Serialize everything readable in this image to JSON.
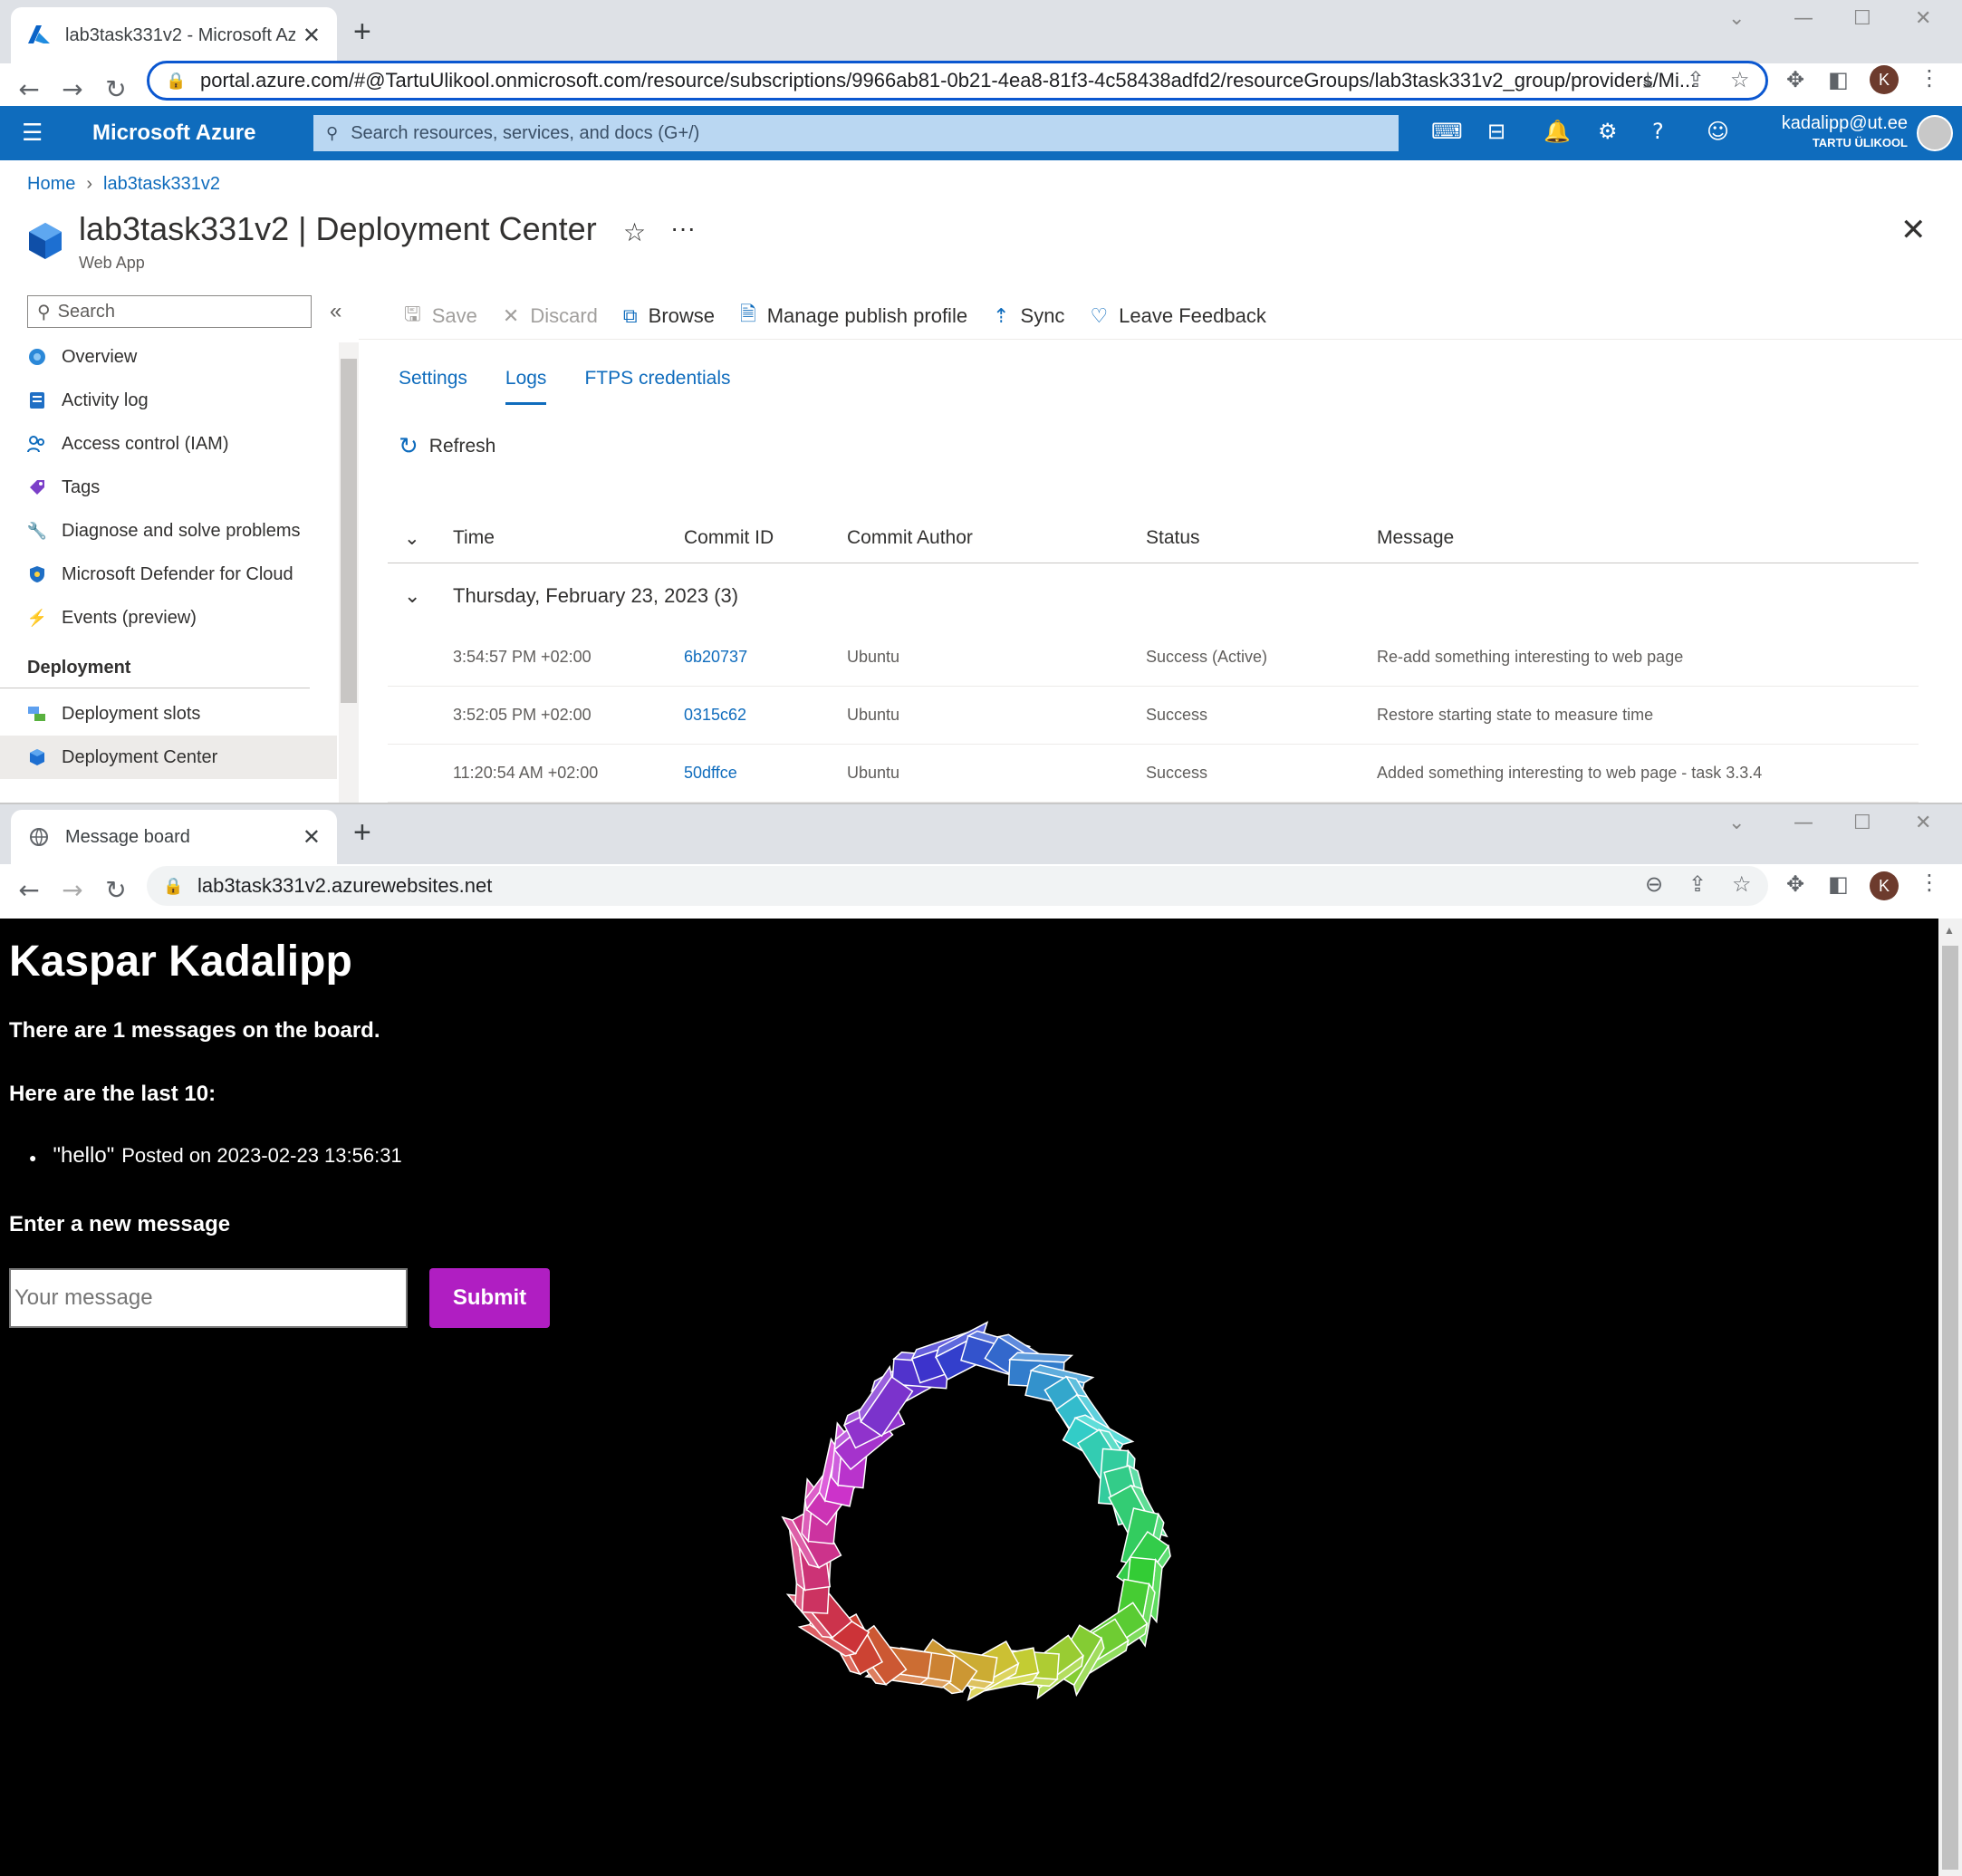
{
  "browser1": {
    "tab_title": "lab3task331v2 - Microsoft Azure",
    "url": "portal.azure.com/#@TartuUlikool.onmicrosoft.com/resource/subscriptions/9966ab81-0b21-4ea8-81f3-4c58438adfd2/resourceGroups/lab3task331v2_group/providers/Mi...",
    "profile_initial": "K"
  },
  "azure": {
    "brand": "Microsoft Azure",
    "search_placeholder": "Search resources, services, and docs (G+/)",
    "user_email": "kadalipp@ut.ee",
    "user_org": "TARTU ÜLIKOOL",
    "breadcrumb": [
      "Home",
      "lab3task331v2"
    ],
    "title": "lab3task331v2 | Deployment Center",
    "subtitle": "Web App",
    "side_search": "Search",
    "nav": [
      {
        "label": "Overview",
        "icon": "globe-icon"
      },
      {
        "label": "Activity log",
        "icon": "log-icon"
      },
      {
        "label": "Access control (IAM)",
        "icon": "people-icon"
      },
      {
        "label": "Tags",
        "icon": "tag-icon"
      },
      {
        "label": "Diagnose and solve problems",
        "icon": "wrench-icon"
      },
      {
        "label": "Microsoft Defender for Cloud",
        "icon": "shield-icon"
      },
      {
        "label": "Events (preview)",
        "icon": "lightning-icon"
      }
    ],
    "nav_section": "Deployment",
    "nav2": [
      {
        "label": "Deployment slots",
        "icon": "slots-icon"
      },
      {
        "label": "Deployment Center",
        "icon": "cube-icon"
      }
    ],
    "toolbar": {
      "save": "Save",
      "discard": "Discard",
      "browse": "Browse",
      "manage": "Manage publish profile",
      "sync": "Sync",
      "feedback": "Leave Feedback"
    },
    "tabs": [
      "Settings",
      "Logs",
      "FTPS credentials"
    ],
    "refresh": "Refresh",
    "columns": [
      "Time",
      "Commit ID",
      "Commit Author",
      "Status",
      "Message"
    ],
    "group_label": "Thursday, February 23, 2023 (3)",
    "rows": [
      [
        "3:54:57 PM +02:00",
        "6b20737",
        "Ubuntu",
        "Success (Active)",
        "Re-add something interesting to web page"
      ],
      [
        "3:52:05 PM +02:00",
        "0315c62",
        "Ubuntu",
        "Success",
        "Restore starting state to measure time"
      ],
      [
        "11:20:54 AM +02:00",
        "50dffce",
        "Ubuntu",
        "Success",
        "Added something interesting to web page - task 3.3.4"
      ]
    ]
  },
  "browser2": {
    "tab_title": "Message board",
    "url": "lab3task331v2.azurewebsites.net",
    "profile_initial": "K"
  },
  "board": {
    "heading": "Kaspar Kadalipp",
    "count_text": "There are 1 messages on the board.",
    "last_text": "Here are the last 10:",
    "messages": [
      {
        "text": "\"hello\"",
        "posted": "Posted on 2023-02-23 13:56:31"
      }
    ],
    "new_label": "Enter a new message",
    "input_placeholder": "Your message",
    "submit": "Submit"
  }
}
